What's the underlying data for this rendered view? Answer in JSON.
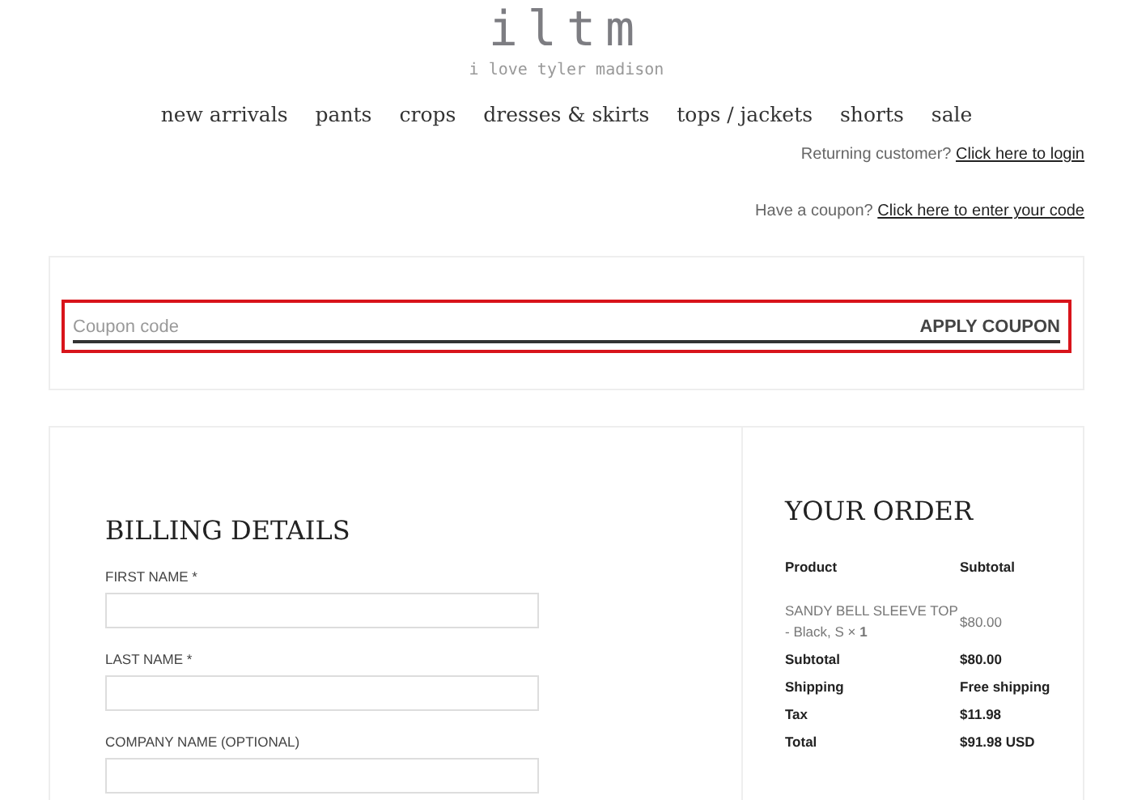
{
  "logo": {
    "name": "iltm",
    "tagline": "i love tyler madison"
  },
  "nav": [
    "new arrivals",
    "pants",
    "crops",
    "dresses & skirts",
    "tops / jackets",
    "shorts",
    "sale"
  ],
  "notices": [
    {
      "text": "Returning customer?",
      "link": "Click here to login"
    },
    {
      "text": "Have a coupon?",
      "link": "Click here to enter your code"
    }
  ],
  "coupon": {
    "placeholder": "Coupon code",
    "button": "APPLY COUPON",
    "highlighted": true
  },
  "billing": {
    "title": "BILLING DETAILS",
    "fields": [
      {
        "label": "FIRST NAME *"
      },
      {
        "label": "LAST NAME *"
      },
      {
        "label": "COMPANY NAME (OPTIONAL)"
      }
    ]
  },
  "order": {
    "title": "YOUR ORDER",
    "columns": [
      "Product",
      "Subtotal"
    ],
    "items": [
      {
        "product": "SANDY BELL SLEEVE TOP - Black, S  × **1**",
        "subtotal": "$80.00"
      }
    ],
    "totals": [
      {
        "label": "Subtotal",
        "value": "$80.00"
      },
      {
        "label": "Shipping",
        "value": "Free shipping"
      },
      {
        "label": "Tax",
        "value": "$11.98"
      },
      {
        "label": "Total",
        "value": "$91.98 USD"
      }
    ]
  }
}
